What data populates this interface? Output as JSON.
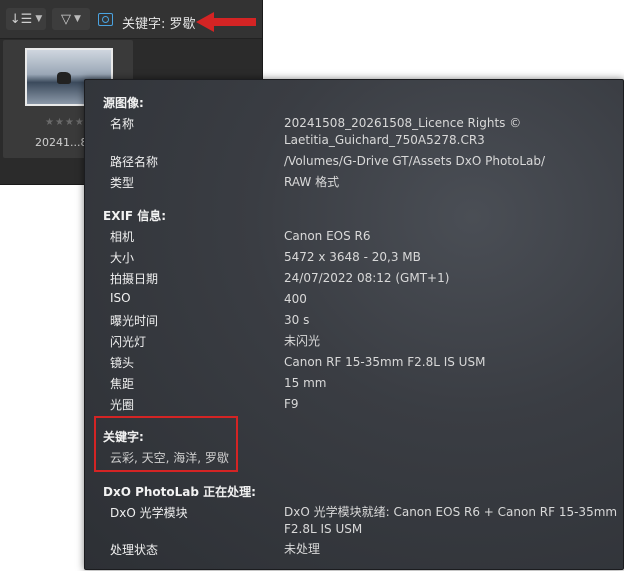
{
  "toolbar": {
    "sort_icon": "sort-icon",
    "filter_icon": "filter-icon",
    "search_text": "关键字: 罗歇"
  },
  "thumbnail": {
    "label": "20241...8...",
    "rating": "★★★★★"
  },
  "popup": {
    "source_title": "源图像:",
    "name_label": "名称",
    "name_value_1": "20241508_20261508_Licence Rights ©",
    "name_value_2": "Laetitia_Guichard_750A5278.CR3",
    "path_label": "路径名称",
    "path_value": "/Volumes/G-Drive GT/Assets DxO PhotoLab/",
    "type_label": "类型",
    "type_value": "RAW 格式",
    "exif_title": "EXIF 信息:",
    "camera_label": "相机",
    "camera_value": "Canon EOS R6",
    "size_label": "大小",
    "size_value": "5472 x 3648 - 20,3 MB",
    "date_label": "拍摄日期",
    "date_value": "24/07/2022 08:12 (GMT+1)",
    "iso_label": "ISO",
    "iso_value": "400",
    "exposure_label": "曝光时间",
    "exposure_value": "30 s",
    "flash_label": "闪光灯",
    "flash_value": "未闪光",
    "lens_label": "镜头",
    "lens_value": "Canon RF 15-35mm F2.8L IS USM",
    "focal_label": "焦距",
    "focal_value": "15 mm",
    "aperture_label": "光圈",
    "aperture_value": "F9",
    "keywords_title": "关键字:",
    "keywords_value": "云彩, 天空, 海洋, 罗歇",
    "processing_title": "DxO PhotoLab 正在处理:",
    "module_label": "DxO 光学模块",
    "module_value_1": "DxO 光学模块就绪: Canon EOS R6 + Canon RF 15-35mm",
    "module_value_2": "F2.8L IS USM",
    "status_label": "处理状态",
    "status_value": "未处理"
  },
  "colors": {
    "highlight_red": "#d42424",
    "accent_blue": "#4aa3e0"
  }
}
